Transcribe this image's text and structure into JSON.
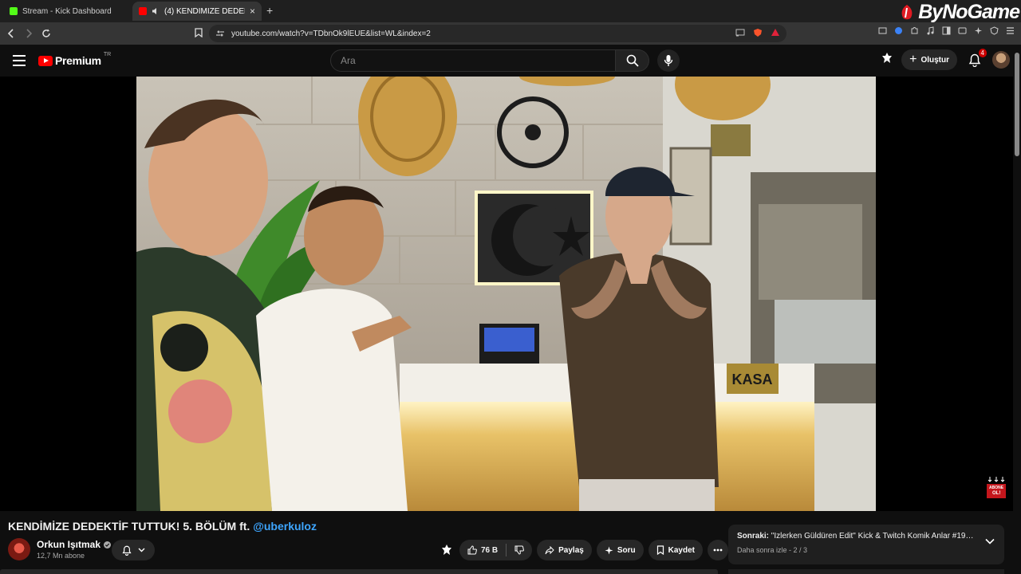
{
  "browser": {
    "tabs": [
      {
        "label": "Stream - Kick Dashboard",
        "favicon_color": "#53fc18"
      },
      {
        "label": "(4) KENDİMİZE DEDEKTİF TUT",
        "favicon_color": "#ff0000"
      }
    ],
    "new_tab": "+",
    "close_tab": "×",
    "url": "youtube.com/watch?v=TDbnOk9lEUE&list=WL&index=2",
    "watermark": "ByNoGame"
  },
  "masthead": {
    "logo_text": "Premium",
    "region": "TR",
    "search_placeholder": "Ara",
    "create_label": "Oluştur",
    "notification_count": "4"
  },
  "video": {
    "title": "KENDİMİZE DEDEKTİF TUTTUK! 5. BÖLÜM ft.",
    "mention": "@uberkuloz",
    "scene_sign": "KASA"
  },
  "channel": {
    "name": "Orkun Işıtmak",
    "subscribers": "12,7 Mn abone",
    "verified": true
  },
  "actions": {
    "likes": "76 B",
    "share": "Paylaş",
    "ask": "Soru",
    "save": "Kaydet"
  },
  "next": {
    "prefix": "Sonraki:",
    "title": "\"İzlerken Güldüren Edit\" Kick & Twitch Komik Anlar #198 | The ...",
    "sub": "Daha sonra izle - 2 / 3"
  },
  "overlay": {
    "abone_line1": "ABONE",
    "abone_line2": "OL!"
  },
  "colors": {
    "accent_red": "#ff0000",
    "link_blue": "#3ea6ff",
    "bg": "#0f0f0f"
  }
}
